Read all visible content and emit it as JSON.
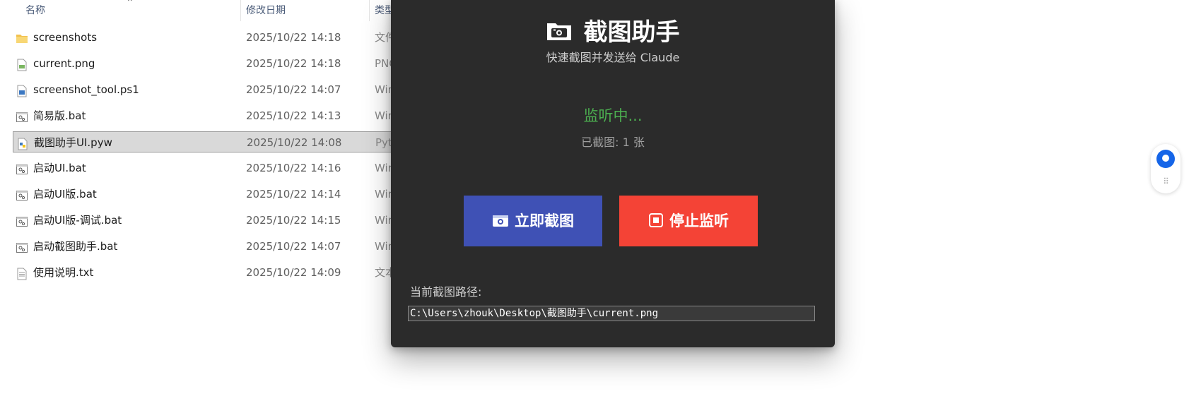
{
  "explorer": {
    "columns": {
      "name": "名称",
      "date": "修改日期",
      "type": "类型"
    },
    "rows": [
      {
        "name": "screenshots",
        "date": "2025/10/22 14:18",
        "type": "文件",
        "icon": "folder-icon"
      },
      {
        "name": "current.png",
        "date": "2025/10/22 14:18",
        "type": "PNG",
        "icon": "image-file-icon"
      },
      {
        "name": "screenshot_tool.ps1",
        "date": "2025/10/22 14:07",
        "type": "Win",
        "icon": "powershell-file-icon"
      },
      {
        "name": "简易版.bat",
        "date": "2025/10/22 14:13",
        "type": "Win",
        "icon": "batch-file-icon"
      },
      {
        "name": "截图助手UI.pyw",
        "date": "2025/10/22 14:08",
        "type": "Pyt",
        "icon": "python-file-icon"
      },
      {
        "name": "启动UI.bat",
        "date": "2025/10/22 14:16",
        "type": "Win",
        "icon": "batch-file-icon"
      },
      {
        "name": "启动UI版.bat",
        "date": "2025/10/22 14:14",
        "type": "Win",
        "icon": "batch-file-icon"
      },
      {
        "name": "启动UI版-调试.bat",
        "date": "2025/10/22 14:15",
        "type": "Win",
        "icon": "batch-file-icon"
      },
      {
        "name": "启动截图助手.bat",
        "date": "2025/10/22 14:07",
        "type": "Win",
        "icon": "batch-file-icon"
      },
      {
        "name": "使用说明.txt",
        "date": "2025/10/22 14:09",
        "type": "文本",
        "icon": "text-file-icon"
      }
    ],
    "selected_row": "截图助手UI.pyw"
  },
  "dialog": {
    "title": "截图助手",
    "subtitle": "快速截图并发送给 Claude",
    "status": "监听中...",
    "count": "已截图: 1 张",
    "capture_button": "立即截图",
    "stop_button": "停止监听",
    "path_label": "当前截图路径:",
    "path_value": "C:\\Users\\zhouk\\Desktop\\截图助手\\current.png"
  },
  "colors": {
    "dialog_bg": "#2b2b2b",
    "status_green": "#4caf50",
    "capture_blue": "#3f51b5",
    "stop_red": "#f44336",
    "selection_gray": "#d9d9d9",
    "widget_blue": "#1565e8"
  }
}
